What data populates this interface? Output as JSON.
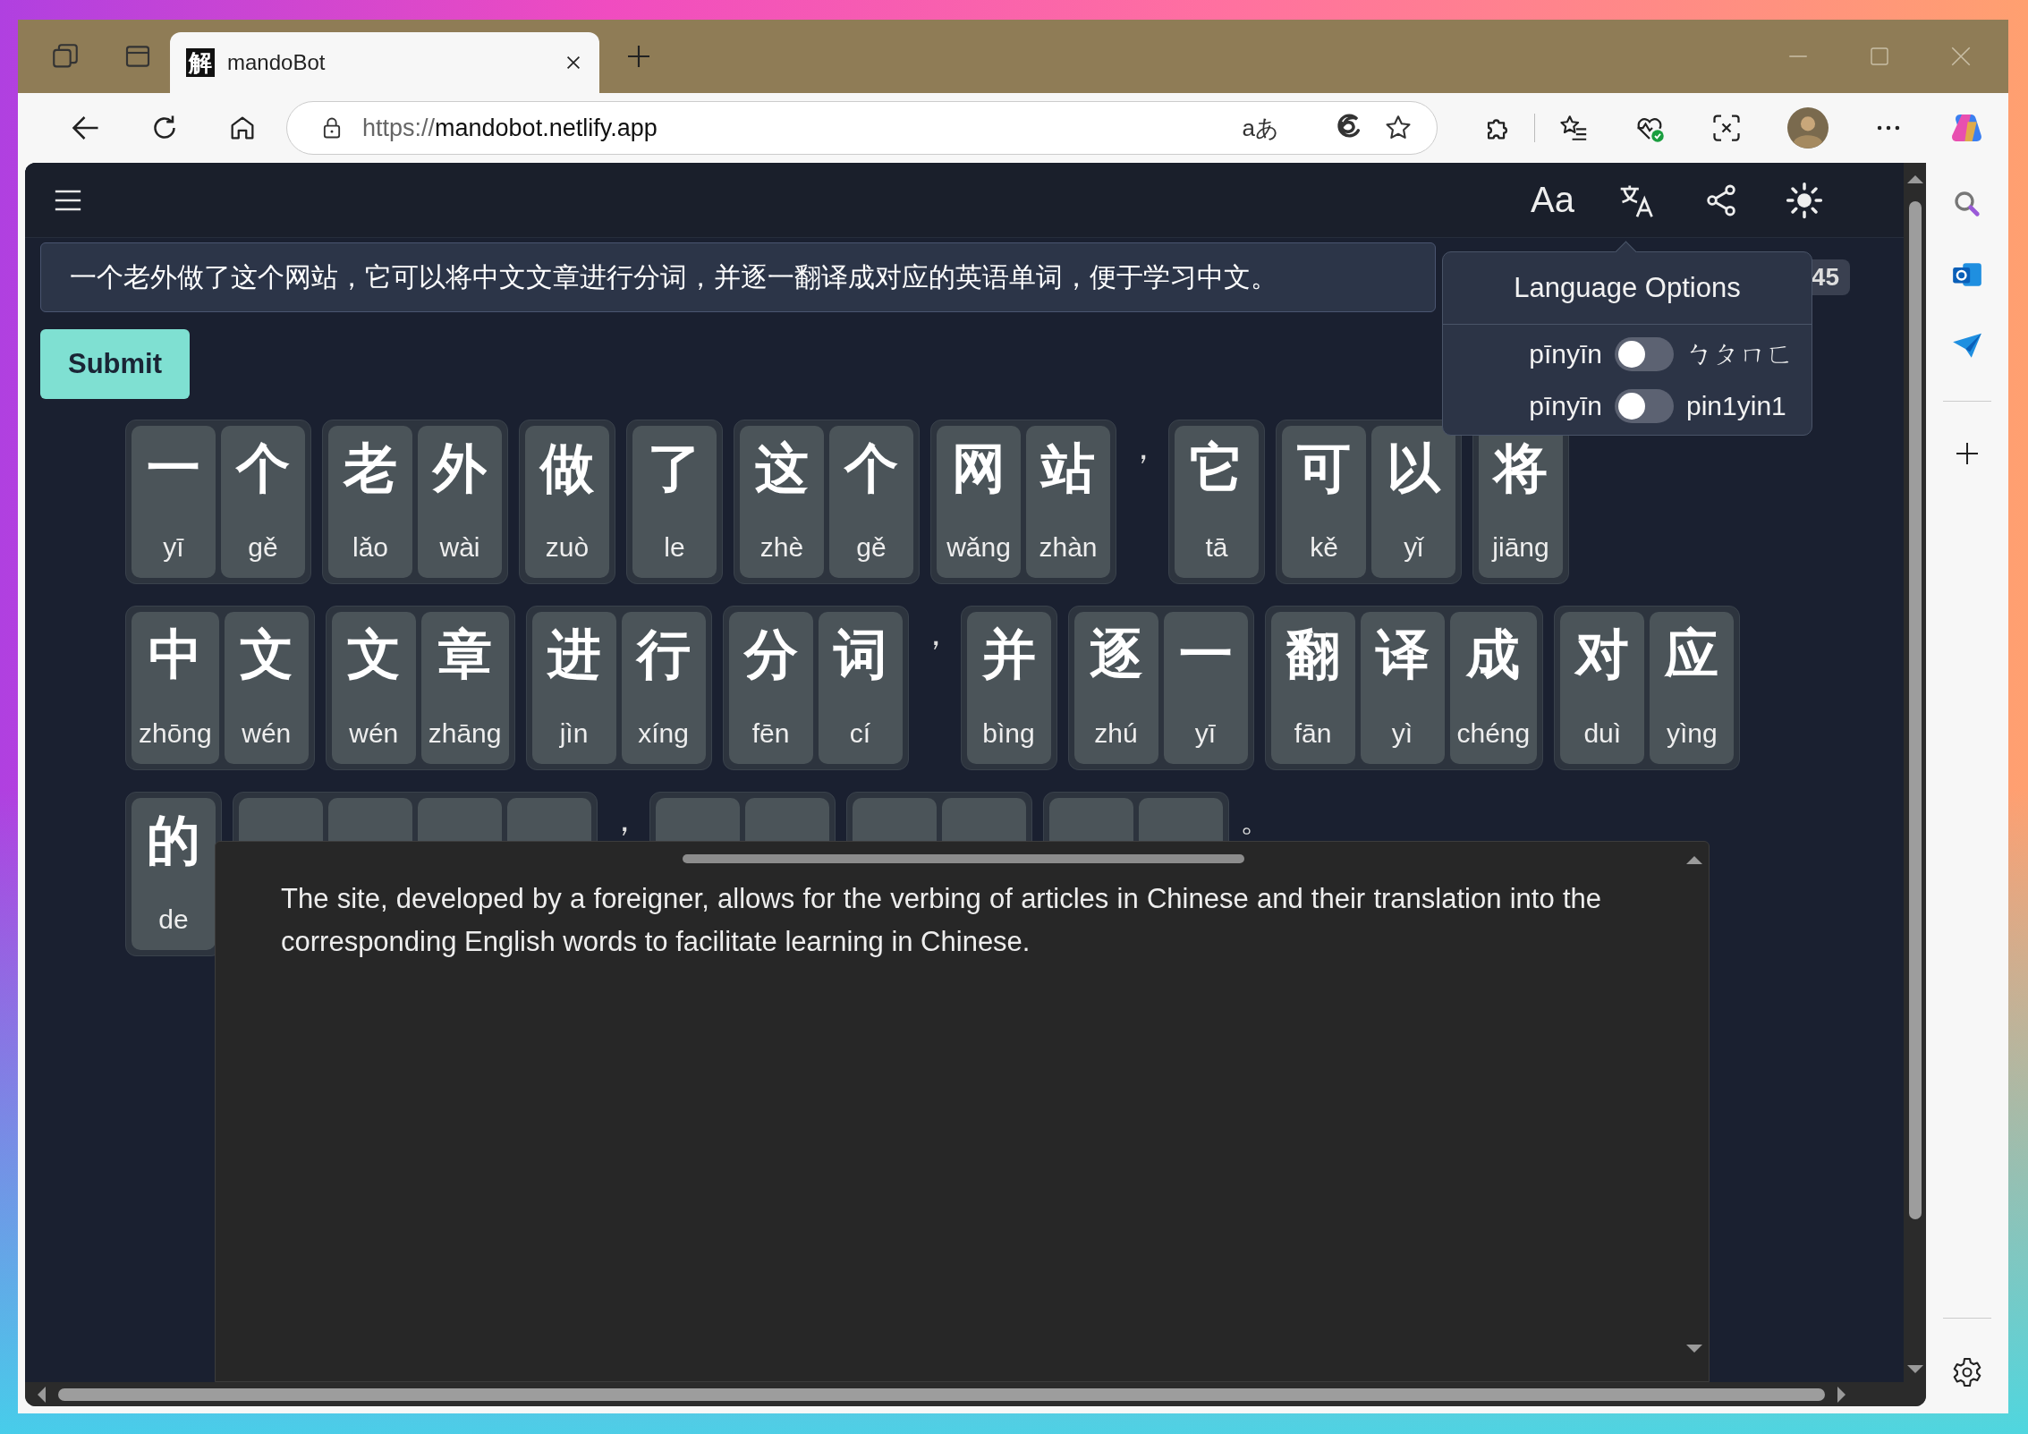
{
  "browser": {
    "tab": {
      "favicon": "解",
      "title": "mandoBot"
    },
    "url": {
      "scheme": "https://",
      "host": "mandobot.netlify.app"
    },
    "translate_glyph": "aあ"
  },
  "app_header": {
    "font_glyph": "Aa"
  },
  "input": {
    "value": "一个老外做了这个网站，它可以将中文文章进行分词，并逐一翻译成对应的英语单词，便于学习中文。"
  },
  "count_badge": "45",
  "submit": "Submit",
  "text_rows": [
    [
      {
        "kind": "word",
        "syllables": [
          {
            "hanzi": "一",
            "pinyin": "yī"
          },
          {
            "hanzi": "个",
            "pinyin": "gě"
          }
        ]
      },
      {
        "kind": "word",
        "syllables": [
          {
            "hanzi": "老",
            "pinyin": "lǎo"
          },
          {
            "hanzi": "外",
            "pinyin": "wài"
          }
        ]
      },
      {
        "kind": "word",
        "syllables": [
          {
            "hanzi": "做",
            "pinyin": "zuò"
          }
        ]
      },
      {
        "kind": "word",
        "syllables": [
          {
            "hanzi": "了",
            "pinyin": "le"
          }
        ]
      },
      {
        "kind": "word",
        "syllables": [
          {
            "hanzi": "这",
            "pinyin": "zhè"
          },
          {
            "hanzi": "个",
            "pinyin": "gě"
          }
        ]
      },
      {
        "kind": "word",
        "syllables": [
          {
            "hanzi": "网",
            "pinyin": "wǎng"
          },
          {
            "hanzi": "站",
            "pinyin": "zhàn"
          }
        ]
      },
      {
        "kind": "punct",
        "text": "，"
      },
      {
        "kind": "word",
        "syllables": [
          {
            "hanzi": "它",
            "pinyin": "tā"
          }
        ]
      },
      {
        "kind": "word",
        "syllables": [
          {
            "hanzi": "可",
            "pinyin": "kě"
          },
          {
            "hanzi": "以",
            "pinyin": "yǐ"
          }
        ]
      },
      {
        "kind": "word",
        "syllables": [
          {
            "hanzi": "将",
            "pinyin": "jiāng"
          }
        ]
      }
    ],
    [
      {
        "kind": "word",
        "syllables": [
          {
            "hanzi": "中",
            "pinyin": "zhōng"
          },
          {
            "hanzi": "文",
            "pinyin": "wén"
          }
        ]
      },
      {
        "kind": "word",
        "syllables": [
          {
            "hanzi": "文",
            "pinyin": "wén"
          },
          {
            "hanzi": "章",
            "pinyin": "zhāng"
          }
        ]
      },
      {
        "kind": "word",
        "syllables": [
          {
            "hanzi": "进",
            "pinyin": "jìn"
          },
          {
            "hanzi": "行",
            "pinyin": "xíng"
          }
        ]
      },
      {
        "kind": "word",
        "syllables": [
          {
            "hanzi": "分",
            "pinyin": "fēn"
          },
          {
            "hanzi": "词",
            "pinyin": "cí"
          }
        ]
      },
      {
        "kind": "punct",
        "text": "，"
      },
      {
        "kind": "word",
        "syllables": [
          {
            "hanzi": "并",
            "pinyin": "bìng"
          }
        ]
      },
      {
        "kind": "word",
        "syllables": [
          {
            "hanzi": "逐",
            "pinyin": "zhú"
          },
          {
            "hanzi": "一",
            "pinyin": "yī"
          }
        ]
      },
      {
        "kind": "word",
        "syllables": [
          {
            "hanzi": "翻",
            "pinyin": "fān"
          },
          {
            "hanzi": "译",
            "pinyin": "yì"
          },
          {
            "hanzi": "成",
            "pinyin": "chéng"
          }
        ]
      },
      {
        "kind": "word",
        "syllables": [
          {
            "hanzi": "对",
            "pinyin": "duì"
          },
          {
            "hanzi": "应",
            "pinyin": "yìng"
          }
        ]
      }
    ],
    [
      {
        "kind": "word",
        "syllables": [
          {
            "hanzi": "的",
            "pinyin": "de"
          }
        ]
      },
      {
        "kind": "covered_word",
        "cards": [
          {
            "kind": "card"
          },
          {
            "kind": "card"
          },
          {
            "kind": "card"
          },
          {
            "kind": "card"
          }
        ]
      },
      {
        "kind": "punct",
        "text": "，"
      },
      {
        "kind": "covered_word",
        "cards": [
          {
            "kind": "card"
          },
          {
            "kind": "card"
          }
        ]
      },
      {
        "kind": "covered_word",
        "cards": [
          {
            "kind": "card"
          },
          {
            "kind": "card"
          }
        ]
      },
      {
        "kind": "covered_word",
        "cards": [
          {
            "kind": "card"
          },
          {
            "kind": "card"
          }
        ]
      },
      {
        "kind": "punct",
        "text": "。"
      }
    ]
  ],
  "translation": {
    "text": "The site, developed by a foreigner, allows for the verbing of articles in Chinese and their translation into the corresponding English words to facilitate learning in Chinese."
  },
  "language_options": {
    "title": "Language Options",
    "options": [
      {
        "left": "pīnyīn",
        "on": false,
        "right": "ㄅㄆㄇㄈ"
      },
      {
        "left": "pīnyīn",
        "on": false,
        "right": "pin1yin1"
      }
    ]
  }
}
